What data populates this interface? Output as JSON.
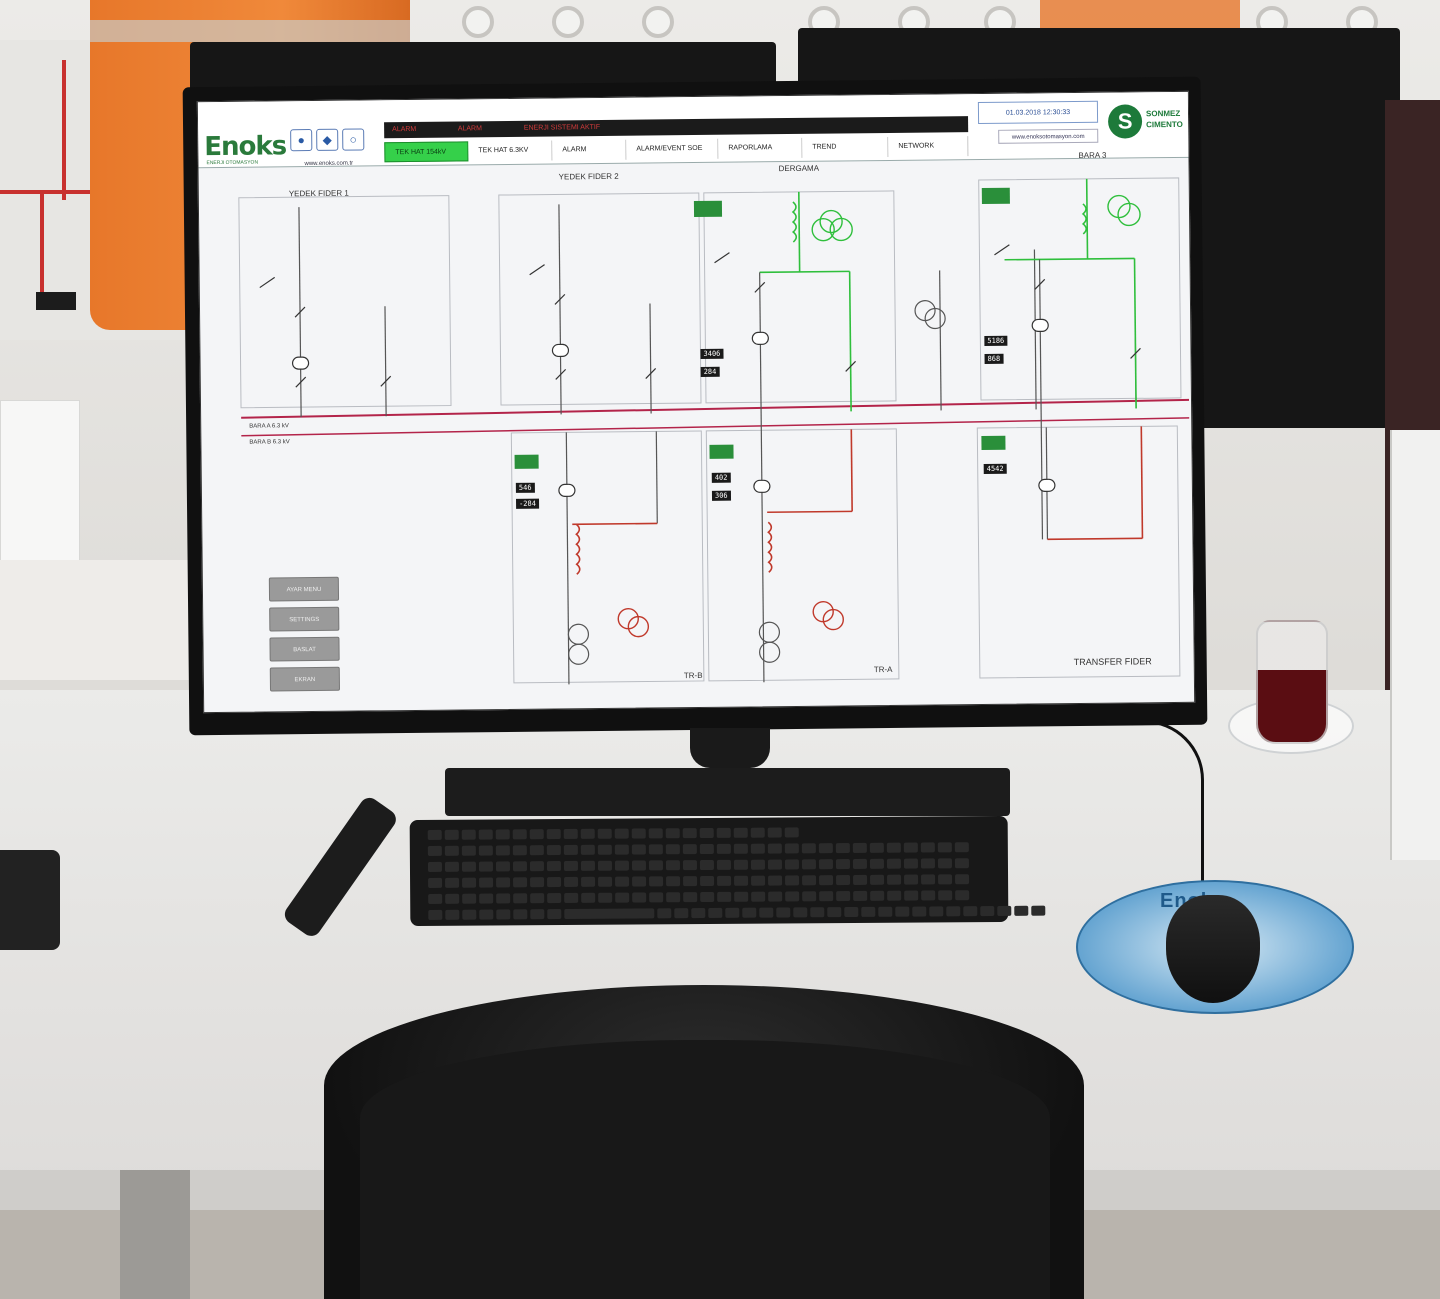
{
  "hmi": {
    "logo": "Enoks",
    "logo_sub": "ENERJI OTOMASYON",
    "website": "www.enoks.com.tr",
    "date_time": "01.03.2018 12:30:33",
    "site": "www.enoksotomasyon.com",
    "brand": "SONMEZ CIMENTO",
    "brand_mark": "S",
    "alarm_texts": [
      "ALARM",
      "ALARM",
      "ENERJI SISTEMI AKTIF"
    ],
    "tabs": [
      "TEK HAT 154kV",
      "TEK HAT 6.3KV",
      "ALARM",
      "ALARM/EVENT SOE",
      "RAPORLAMA",
      "TREND",
      "NETWORK"
    ],
    "active_tab": 0
  },
  "diagram": {
    "feeders": [
      "YEDEK FIDER 1",
      "YEDEK FIDER 2",
      "DERGAMA",
      "BARA 3"
    ],
    "bottom_labels": [
      "TR-B",
      "TR-A",
      "TRANSFER FIDER"
    ],
    "side_buttons": [
      "AYAR MENU",
      "SETTINGS",
      "BASLAT",
      "EKRAN"
    ],
    "values": [
      "3406",
      "284",
      "5186",
      "868",
      "546",
      "-284",
      "402",
      "306",
      "4542"
    ],
    "bus_label_1": "BARA A 6.3 kV",
    "bus_label_2": "BARA B 6.3 kV"
  },
  "mousepad": {
    "text": "Enoks"
  },
  "colors": {
    "bus_line": "#b3244a",
    "energized": "#2fbf3c",
    "header_tab_active": "#35d04a",
    "brand_green": "#1d7a3a"
  }
}
